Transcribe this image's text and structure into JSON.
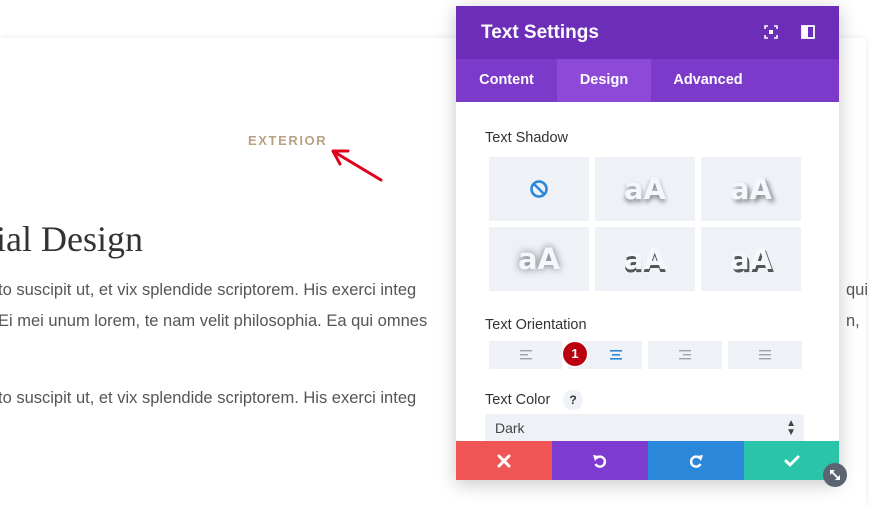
{
  "page": {
    "eyebrow": "EXTERIOR",
    "heading": "ial Design",
    "paragraphs": [
      "to suscipit ut, et vix splendide scriptorem. His exerci integ",
      "Ei mei unum lorem, te nam velit philosophia. Ea qui omnes",
      "to suscipit ut, et vix splendide scriptorem. His exerci integ"
    ],
    "overflow_right": [
      "qui",
      "n,"
    ]
  },
  "modal": {
    "title": "Text Settings",
    "header_icons": [
      "expand-icon",
      "sidebar-layout-icon"
    ],
    "tabs": [
      {
        "label": "Content",
        "active": false
      },
      {
        "label": "Design",
        "active": true
      },
      {
        "label": "Advanced",
        "active": false
      }
    ],
    "text_shadow": {
      "label": "Text Shadow",
      "preview_text": "aA",
      "options": [
        "none",
        "shadow-1",
        "shadow-2",
        "shadow-3",
        "shadow-4",
        "shadow-5"
      ]
    },
    "text_orientation": {
      "label": "Text Orientation",
      "options": [
        "left",
        "center",
        "right",
        "justify"
      ],
      "selected": "center",
      "badge": "1"
    },
    "text_color": {
      "label": "Text Color",
      "help": "?",
      "value": "Dark"
    },
    "footer": [
      "close-icon",
      "undo-icon",
      "redo-icon",
      "check-icon"
    ]
  },
  "colors": {
    "header": "#6c2eb9",
    "tabs": "#7b3ac9",
    "tab_active": "#8d4ad8",
    "cancel": "#ef5555",
    "undo": "#7e3bd0",
    "redo": "#2b87da",
    "save": "#29c4a9",
    "badge": "#b8000f",
    "annotation_arrow": "#e0001a",
    "eyebrow": "#b9a283"
  }
}
